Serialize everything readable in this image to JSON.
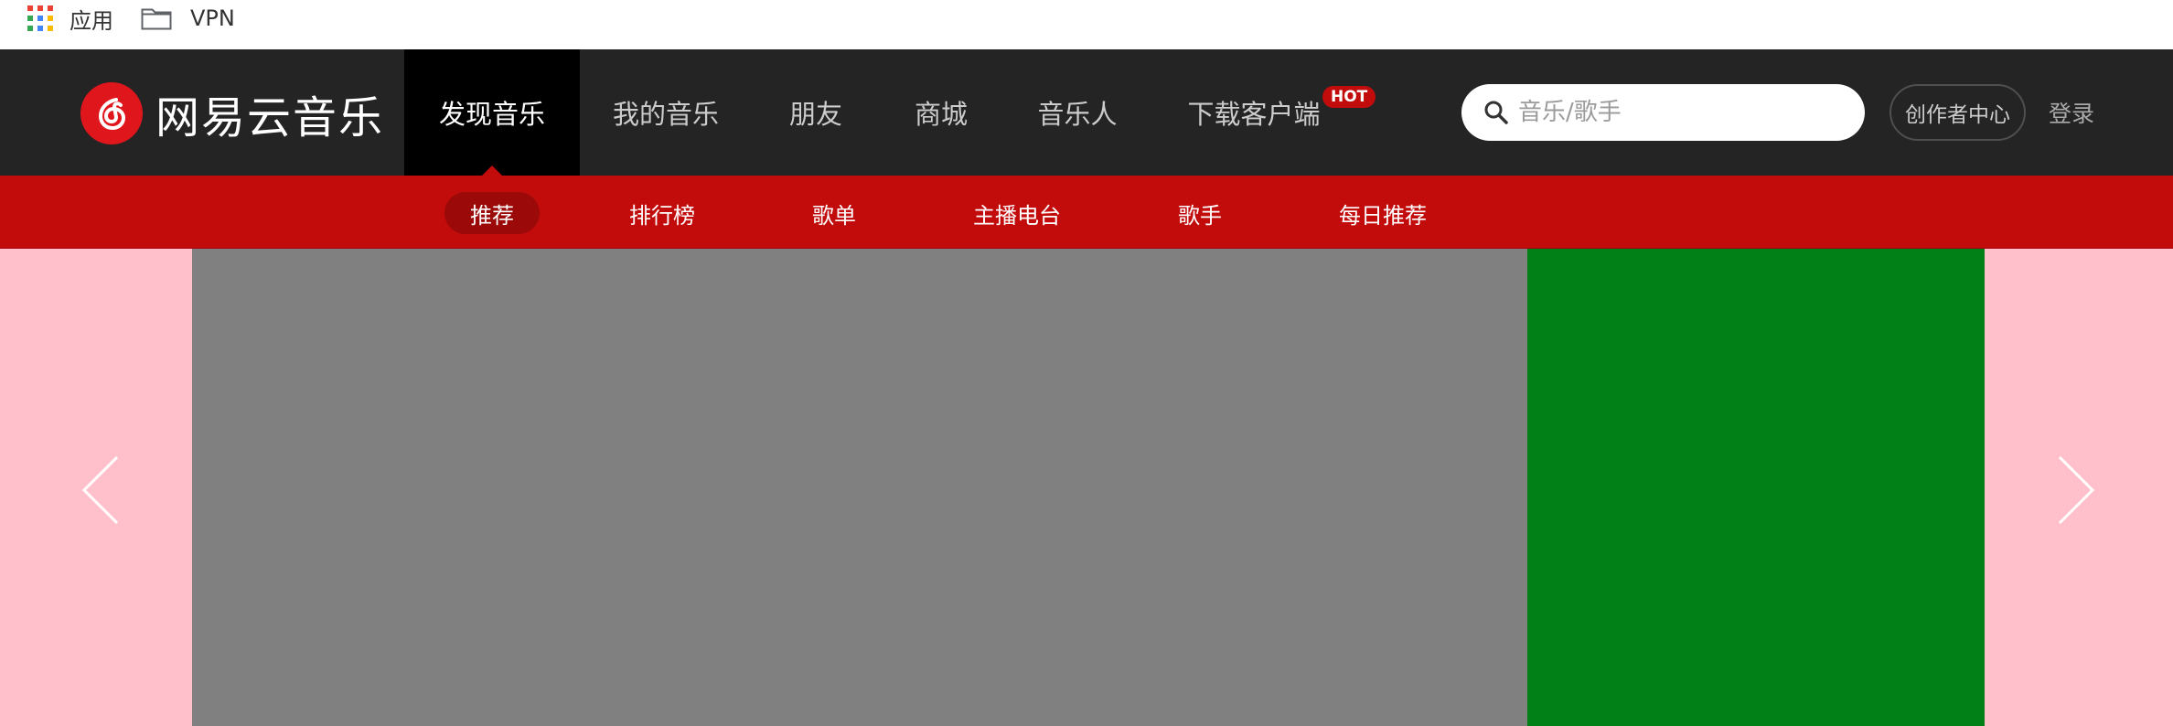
{
  "bookmarks": {
    "apps_label": "应用",
    "vpn_label": "VPN",
    "icons": [
      "apps-grid-icon",
      "folder-icon"
    ]
  },
  "header": {
    "logo_text": "网易云音乐",
    "nav": [
      {
        "label": "发现音乐",
        "active": true
      },
      {
        "label": "我的音乐",
        "active": false
      },
      {
        "label": "朋友",
        "active": false
      },
      {
        "label": "商城",
        "active": false
      },
      {
        "label": "音乐人",
        "active": false
      },
      {
        "label": "下载客户端",
        "active": false,
        "badge": "HOT"
      }
    ],
    "search": {
      "placeholder": "音乐/歌手",
      "value": ""
    },
    "creator_label": "创作者中心",
    "login_label": "登录"
  },
  "subnav": {
    "items": [
      {
        "label": "推荐",
        "active": true
      },
      {
        "label": "排行榜",
        "active": false
      },
      {
        "label": "歌单",
        "active": false
      },
      {
        "label": "主播电台",
        "active": false
      },
      {
        "label": "歌手",
        "active": false
      },
      {
        "label": "每日推荐",
        "active": false
      }
    ]
  },
  "colors": {
    "topbar": "#242424",
    "accent_red": "#c20c0c",
    "logo_red": "#e0161d",
    "banner_bg": "#ffc0cb",
    "banner_main": "#808080",
    "banner_side": "#008017"
  }
}
